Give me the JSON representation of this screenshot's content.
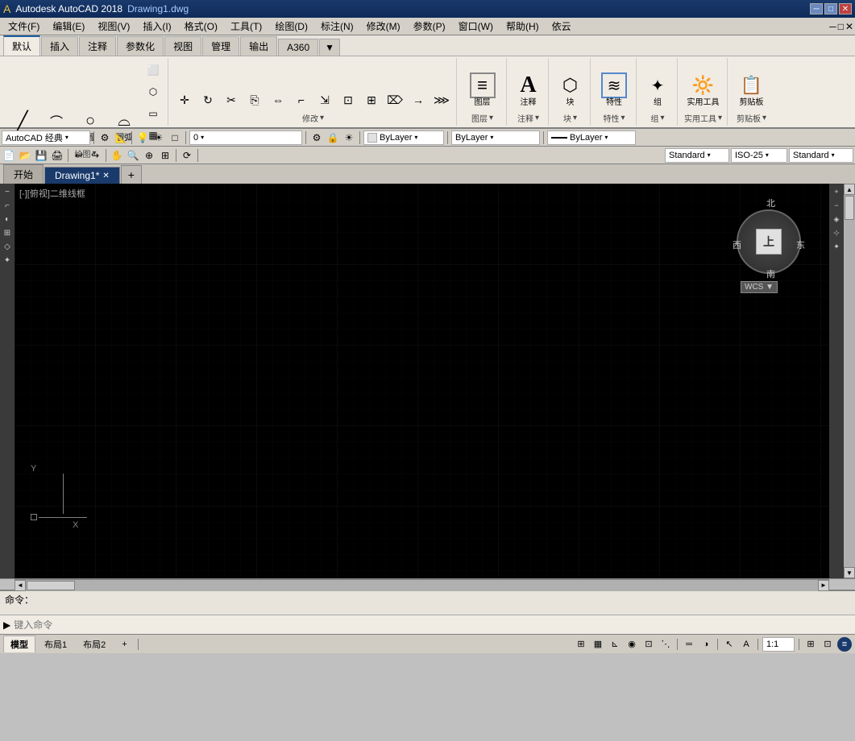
{
  "titlebar": {
    "appname": "Autodesk AutoCAD 2018",
    "filename": "Drawing1.dwg",
    "minimize": "─",
    "restore": "□",
    "close": "✕"
  },
  "menubar": {
    "items": [
      "文件(F)",
      "编辑(E)",
      "视图(V)",
      "插入(I)",
      "格式(O)",
      "工具(T)",
      "绘图(D)",
      "标注(N)",
      "修改(M)",
      "参数(P)",
      "窗口(W)",
      "帮助(H)",
      "依云"
    ]
  },
  "ribbon": {
    "tabs": [
      "默认",
      "插入",
      "注释",
      "参数化",
      "视图",
      "管理",
      "输出",
      "A360",
      "▼"
    ],
    "active_tab": "默认",
    "groups": [
      {
        "label": "绘图",
        "items": [
          {
            "icon": "⟋",
            "label": "直线"
          },
          {
            "icon": "⌒",
            "label": "多段线"
          },
          {
            "icon": "○",
            "label": "圆"
          },
          {
            "icon": "⌓",
            "label": "圆弧"
          }
        ]
      },
      {
        "label": "修改",
        "items": []
      },
      {
        "label": "图层",
        "items": [
          {
            "icon": "≡",
            "label": "图层"
          }
        ]
      },
      {
        "label": "注释",
        "items": [
          {
            "icon": "A",
            "label": "注释"
          }
        ]
      },
      {
        "label": "块",
        "items": [
          {
            "icon": "⬡",
            "label": "块"
          }
        ]
      },
      {
        "label": "特性",
        "items": [
          {
            "icon": "≋",
            "label": "特性"
          }
        ]
      },
      {
        "label": "组",
        "items": [
          {
            "icon": "✦",
            "label": "组"
          }
        ]
      },
      {
        "label": "实用工具",
        "items": [
          {
            "icon": "⊞",
            "label": "实用工具"
          }
        ]
      },
      {
        "label": "剪贴板",
        "items": [
          {
            "icon": "⎘",
            "label": "剪贴板"
          }
        ]
      }
    ]
  },
  "toolbar1": {
    "workspace": "AutoCAD 经典",
    "items": [
      "⚙",
      "📐",
      "💡",
      "☀",
      "□",
      "0"
    ],
    "color_dropdown": "ByLayer",
    "linetype_dropdown": "ByLayer",
    "lineweight_dropdown": "ByLayer"
  },
  "drawingtabs": {
    "tabs": [
      "开始",
      "Drawing1*",
      "+"
    ],
    "active": "Drawing1*"
  },
  "canvas": {
    "viewport_label": "[-][俯视]二维线框",
    "compass": {
      "north": "北",
      "south": "南",
      "east": "东",
      "west": "西",
      "center": "上",
      "wcs": "WCS ▼"
    },
    "coord": {
      "y_label": "Y",
      "x_label": "X"
    }
  },
  "toolbar2": {
    "standard_dropdown": "Standard",
    "iso_dropdown": "ISO-25",
    "standard2_dropdown": "Standard"
  },
  "command": {
    "output": "命令：",
    "prompt": "▶ ",
    "placeholder": "键入命令"
  },
  "statusbar": {
    "model_tab": "模型",
    "layout1_tab": "布局1",
    "layout2_tab": "布局2",
    "add_layout": "+",
    "scale": "1:1"
  }
}
